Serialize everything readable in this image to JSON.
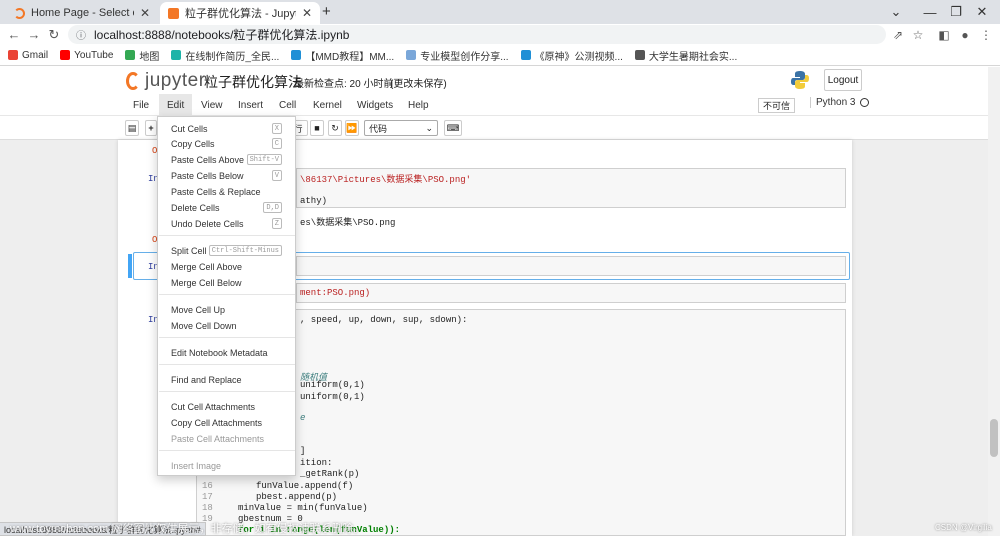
{
  "browser": {
    "tabs": [
      {
        "title": "Home Page - Select or create a n"
      },
      {
        "title": "粒子群优化算法 - Jupyter Notebook"
      }
    ],
    "url": "localhost:8888/notebooks/粒子群优化算法.ipynb",
    "bookmarks": [
      {
        "label": "Gmail",
        "color": "#ea4335"
      },
      {
        "label": "YouTube",
        "color": "#ff0000"
      },
      {
        "label": "地图",
        "color": "#34a853"
      },
      {
        "label": "在线制作简历_全民...",
        "color": "#1db3a8"
      },
      {
        "label": "【MMD教程】MM...",
        "color": "#1f8fd6"
      },
      {
        "label": "专业模型创作分享...",
        "color": "#7aa7d9"
      },
      {
        "label": "《原神》公测视频...",
        "color": "#1f8fd6"
      },
      {
        "label": "大学生暑期社会实...",
        "color": "#555555"
      }
    ],
    "status_url": "localhost:8888/notebooks/粒子群优化算法.ipynb#"
  },
  "jupyter": {
    "logo_text": "jupyter",
    "notebook_name": "粒子群优化算法",
    "checkpoint": "最新检查点: 20 小时前",
    "autosave": "(更改未保存)",
    "logout": "Logout",
    "menus": [
      "File",
      "Edit",
      "View",
      "Insert",
      "Cell",
      "Kernel",
      "Widgets",
      "Help"
    ],
    "trusted": "不可信",
    "kernel": "Python 3",
    "cell_type": "代码",
    "run_label": "行"
  },
  "edit_menu": {
    "items": [
      {
        "label": "Cut Cells",
        "shortcut": "X"
      },
      {
        "label": "Copy Cells",
        "shortcut": "C"
      },
      {
        "label": "Paste Cells Above",
        "shortcut": "Shift-V"
      },
      {
        "label": "Paste Cells Below",
        "shortcut": "V"
      },
      {
        "label": "Paste Cells & Replace",
        "shortcut": ""
      },
      {
        "label": "Delete Cells",
        "shortcut": "D,D"
      },
      {
        "label": "Undo Delete Cells",
        "shortcut": "Z"
      },
      {
        "label": "Split Cell",
        "shortcut": "Ctrl-Shift-Minus"
      },
      {
        "label": "Merge Cell Above",
        "shortcut": ""
      },
      {
        "label": "Merge Cell Below",
        "shortcut": ""
      },
      {
        "label": "Move Cell Up",
        "shortcut": ""
      },
      {
        "label": "Move Cell Down",
        "shortcut": ""
      },
      {
        "label": "Edit Notebook Metadata",
        "shortcut": ""
      },
      {
        "label": "Find and Replace",
        "shortcut": ""
      },
      {
        "label": "Cut Cell Attachments",
        "shortcut": ""
      },
      {
        "label": "Copy Cell Attachments",
        "shortcut": ""
      },
      {
        "label": "Paste Cell Attachments",
        "shortcut": ""
      },
      {
        "label": "Insert Image",
        "shortcut": ""
      }
    ]
  },
  "notebook": {
    "cell1_path": "\\86137\\Pictures\\数据采集\\PSO.png'",
    "cell1_line2": "athy)",
    "cell1_out": "es\\数据采集\\PSO.png",
    "cell3_out": "ment:PSO.png)",
    "code": {
      "l1": ", speed, up, down, sup, sdown):",
      "l2": "随机值",
      "l3": "uniform(0,1)",
      "l4": "uniform(0,1)",
      "l5": "e",
      "l6": "]",
      "l7": "ition:",
      "l8": "_getRank(p)",
      "n16": "16",
      "c16": "funValue.append(f)",
      "n17": "17",
      "c17": "pbest.append(p)",
      "n18": "18",
      "c18": "minValue = min(funValue)",
      "n19": "19",
      "c19": "gbestnum = 0",
      "c20": "for i in range(len(funValue)):"
    }
  },
  "watermark": {
    "left": "www.toymoban.com 网络图片仅供展示，非存储，如有侵权请联系删除。",
    "right": "CSDN @Virgilia"
  }
}
